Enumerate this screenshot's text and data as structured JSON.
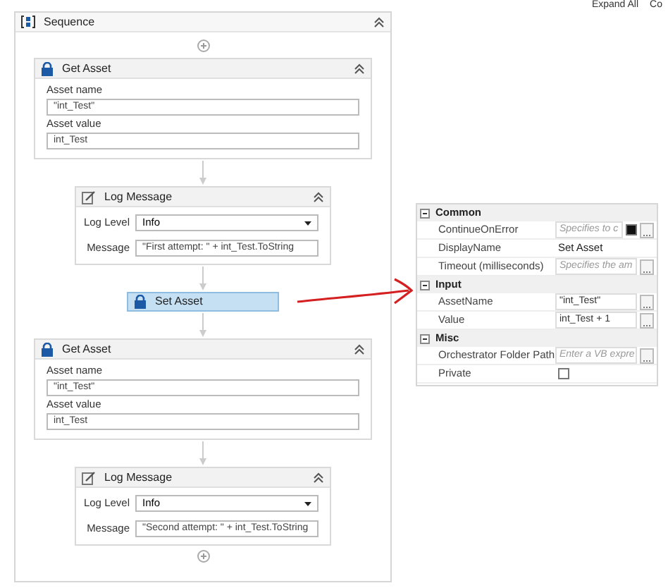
{
  "toolbar": {
    "links": [
      "Expand All",
      "Co"
    ]
  },
  "sequence": {
    "title": "Sequence",
    "expanded": true,
    "activities": [
      {
        "kind": "get_asset",
        "title": "Get Asset",
        "expanded": true,
        "fields": [
          {
            "label": "Asset name",
            "value": "\"int_Test\""
          },
          {
            "label": "Asset value",
            "value": "int_Test"
          }
        ]
      },
      {
        "kind": "log_message",
        "title": "Log Message",
        "expanded": true,
        "level_label": "Log Level",
        "level": "Info",
        "message_label": "Message",
        "message": "\"First attempt: \" + int_Test.ToString"
      },
      {
        "kind": "set_asset",
        "title": "Set Asset",
        "selected": true
      },
      {
        "kind": "get_asset",
        "title": "Get Asset",
        "expanded": true,
        "fields": [
          {
            "label": "Asset name",
            "value": "\"int_Test\""
          },
          {
            "label": "Asset value",
            "value": "int_Test"
          }
        ]
      },
      {
        "kind": "log_message",
        "title": "Log Message",
        "expanded": true,
        "level_label": "Log Level",
        "level": "Info",
        "message_label": "Message",
        "message": "\"Second attempt: \" + int_Test.ToString"
      }
    ]
  },
  "properties": {
    "categories": [
      {
        "name": "Common",
        "expanded": true,
        "rows": [
          {
            "name": "ContinueOnError",
            "kind": "placeholder_check",
            "placeholder": "Specifies to c",
            "checked": true
          },
          {
            "name": "DisplayName",
            "kind": "text",
            "value": "Set Asset"
          },
          {
            "name": "Timeout (milliseconds)",
            "kind": "placeholder",
            "placeholder": "Specifies the am"
          }
        ]
      },
      {
        "name": "Input",
        "expanded": true,
        "rows": [
          {
            "name": "AssetName",
            "kind": "value",
            "value": "\"int_Test\""
          },
          {
            "name": "Value",
            "kind": "value",
            "value": "int_Test + 1"
          }
        ]
      },
      {
        "name": "Misc",
        "expanded": true,
        "rows": [
          {
            "name": "Orchestrator Folder Path",
            "kind": "placeholder",
            "placeholder": "Enter a VB expre"
          },
          {
            "name": "Private",
            "kind": "check",
            "checked": false
          }
        ]
      }
    ]
  }
}
